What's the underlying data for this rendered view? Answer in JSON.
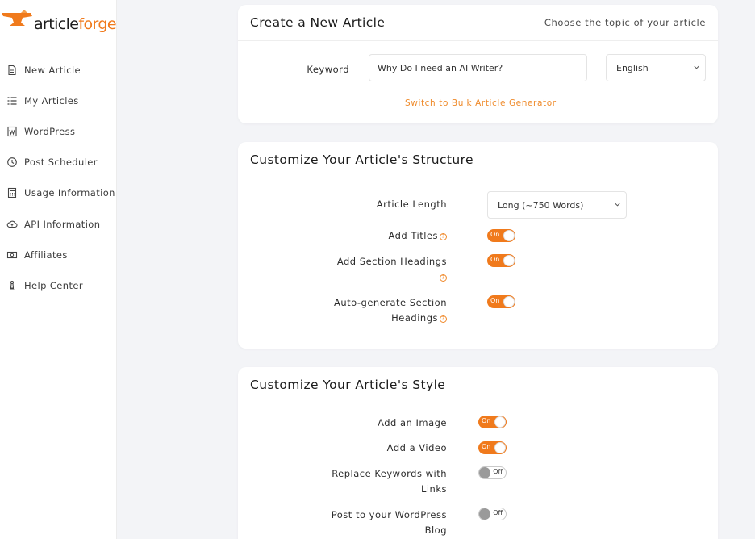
{
  "app": {
    "logo_part1": "article",
    "logo_part2": "forge",
    "accent_color": "#f07a1c"
  },
  "sidebar": {
    "items": [
      {
        "label": "New Article",
        "icon": "document-icon"
      },
      {
        "label": "My Articles",
        "icon": "list-icon"
      },
      {
        "label": "WordPress",
        "icon": "wordpress-icon"
      },
      {
        "label": "Post Scheduler",
        "icon": "clock-icon"
      },
      {
        "label": "Usage Information",
        "icon": "calculator-icon"
      },
      {
        "label": "API Information",
        "icon": "cloud-icon"
      },
      {
        "label": "Affiliates",
        "icon": "money-icon"
      },
      {
        "label": "Help Center",
        "icon": "chess-piece-icon"
      }
    ]
  },
  "create": {
    "title": "Create a New Article",
    "subtitle": "Choose the topic of your article",
    "keyword_label": "Keyword",
    "keyword_value": "Why Do I need an AI Writer?",
    "language_value": "English",
    "bulk_link": "Switch to Bulk Article Generator"
  },
  "structure": {
    "title": "Customize Your Article's Structure",
    "length_label": "Article Length",
    "length_value": "Long (~750 Words)",
    "add_titles_label": "Add Titles",
    "add_titles_state": "On",
    "section_headings_label": "Add Section Headings",
    "section_headings_state": "On",
    "auto_headings_label_1": "Auto-generate Section",
    "auto_headings_label_2": "Headings",
    "auto_headings_state": "On",
    "help_glyph": "?"
  },
  "style": {
    "title": "Customize Your Article's Style",
    "image_label": "Add an Image",
    "image_state": "On",
    "video_label": "Add a Video",
    "video_state": "On",
    "links_label_1": "Replace Keywords with",
    "links_label_2": "Links",
    "links_state": "Off",
    "wp_label_1": "Post to your WordPress",
    "wp_label_2": "Blog",
    "wp_state": "Off"
  }
}
